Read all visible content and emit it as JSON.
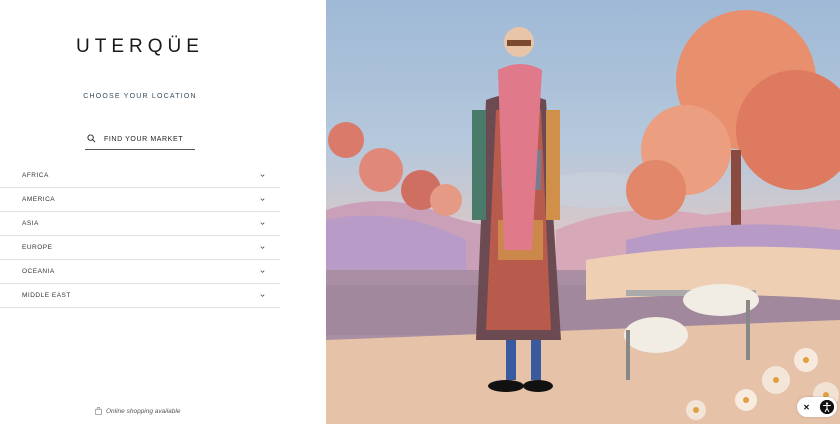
{
  "brand": {
    "logo_text": "UTERQÜE"
  },
  "location": {
    "heading": "CHOOSE YOUR LOCATION",
    "search_placeholder": "FIND YOUR MARKET"
  },
  "regions": [
    {
      "label": "AFRICA"
    },
    {
      "label": "AMERICA"
    },
    {
      "label": "ASIA"
    },
    {
      "label": "EUROPE"
    },
    {
      "label": "OCEANIA"
    },
    {
      "label": "MIDDLE EAST"
    }
  ],
  "footer": {
    "note": "Online shopping available"
  },
  "widget": {
    "close_label": "✕"
  },
  "icons": {
    "search": "search-icon",
    "chevron": "chevron-down-icon",
    "bag": "shopping-bag-icon",
    "accessibility": "accessibility-icon"
  }
}
